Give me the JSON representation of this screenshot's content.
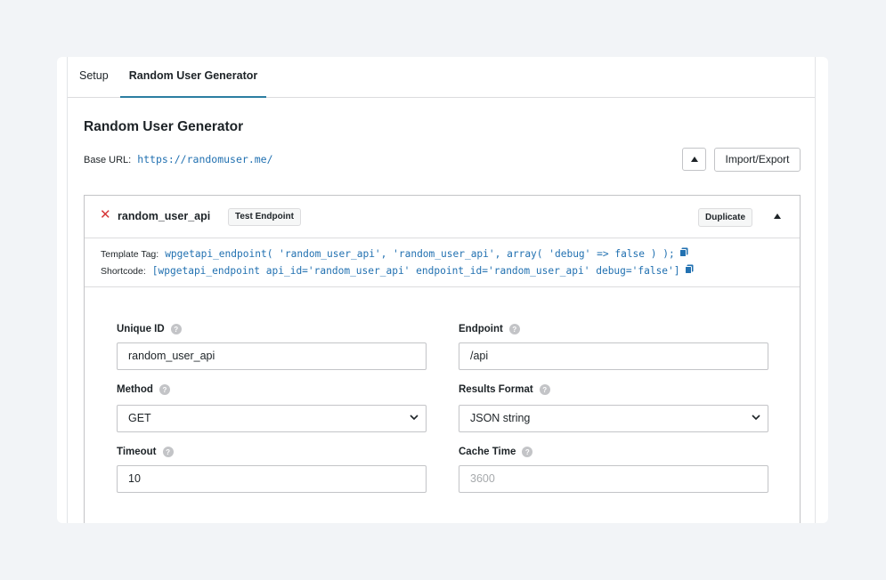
{
  "tabs": [
    {
      "label": "Setup",
      "active": false
    },
    {
      "label": "Random User Generator",
      "active": true
    }
  ],
  "page": {
    "title": "Random User Generator",
    "base_url_label": "Base URL:",
    "base_url_value": "https://randomuser.me/",
    "import_export_label": "Import/Export"
  },
  "endpoint": {
    "name": "random_user_api",
    "test_label": "Test Endpoint",
    "duplicate_label": "Duplicate",
    "template_tag_label": "Template Tag:",
    "template_tag_value": "wpgetapi_endpoint( 'random_user_api', 'random_user_api', array( 'debug' => false ) );",
    "shortcode_label": "Shortcode:",
    "shortcode_value": "[wpgetapi_endpoint api_id='random_user_api' endpoint_id='random_user_api' debug='false']"
  },
  "form": {
    "unique_id": {
      "label": "Unique ID",
      "value": "random_user_api"
    },
    "endpoint": {
      "label": "Endpoint",
      "value": "/api"
    },
    "method": {
      "label": "Method",
      "value": "GET"
    },
    "results_format": {
      "label": "Results Format",
      "value": "JSON string"
    },
    "timeout": {
      "label": "Timeout",
      "value": "10"
    },
    "cache_time": {
      "label": "Cache Time",
      "placeholder": "3600"
    }
  },
  "icons": {
    "help": "?",
    "remove": "✕"
  },
  "colors": {
    "accent": "#2c7ea1",
    "link": "#2271b1",
    "danger": "#d63638",
    "background": "#f2f4f7"
  }
}
